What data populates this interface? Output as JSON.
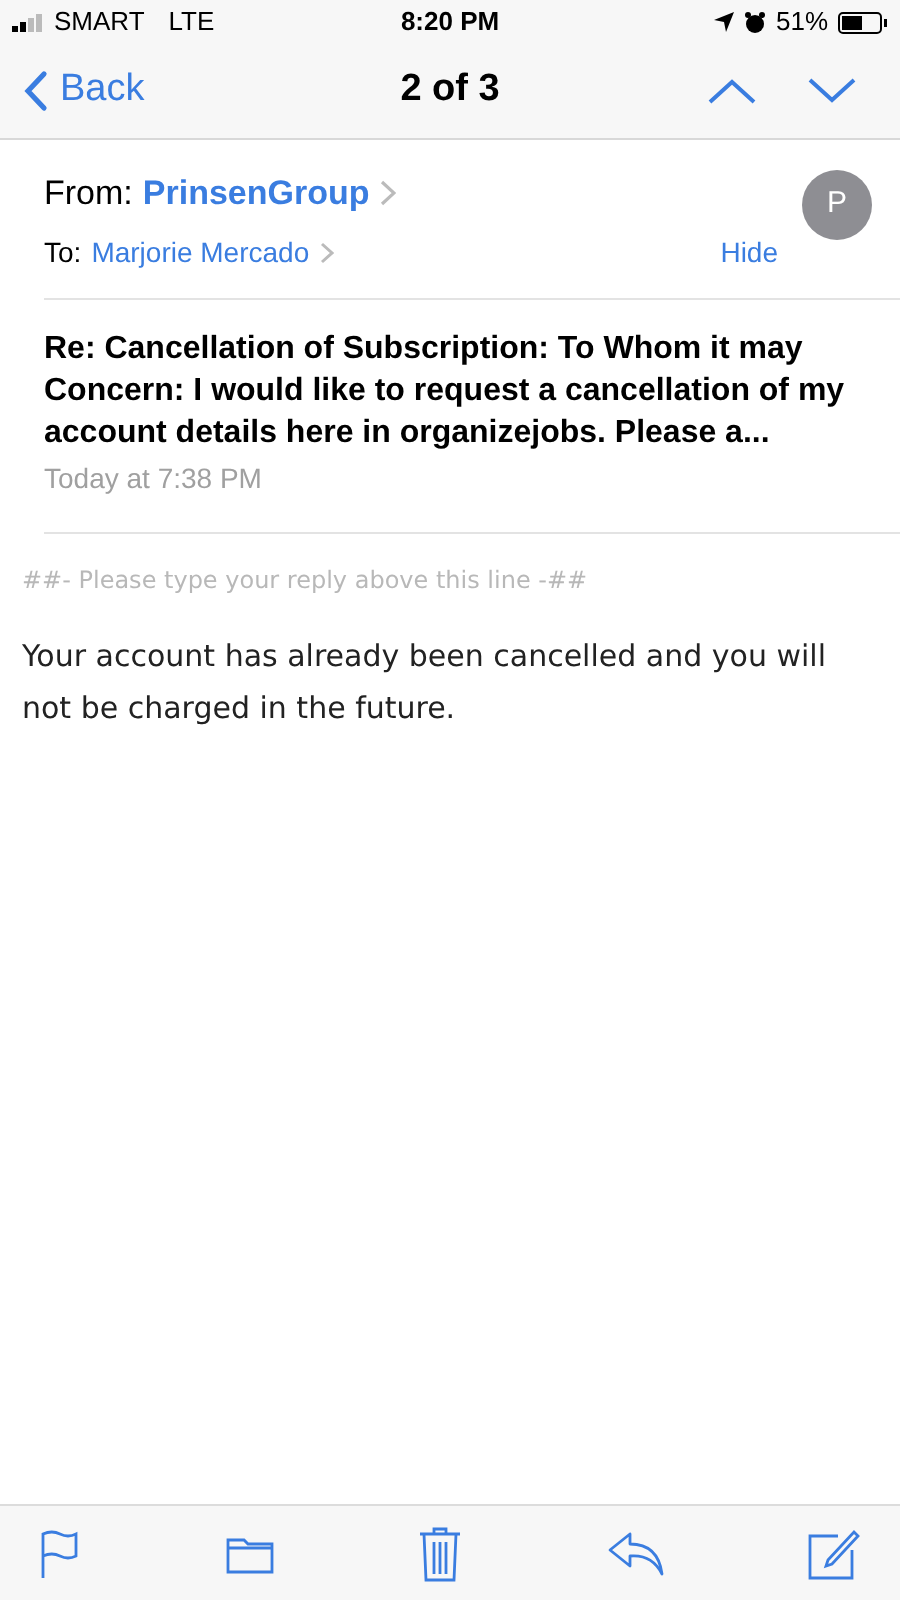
{
  "status_bar": {
    "carrier": "SMART",
    "network": "LTE",
    "time": "8:20 PM",
    "battery": "51%"
  },
  "nav": {
    "back": "Back",
    "title": "2 of 3"
  },
  "header": {
    "from_label": "From:",
    "from": "PrinsenGroup",
    "to_label": "To:",
    "to": "Marjorie Mercado",
    "hide": "Hide",
    "avatar": "P"
  },
  "message": {
    "subject": "Re: Cancellation of Subscription: To Whom it may Concern: I would like to request a cancellation of my account details here in organizejobs. Please a...",
    "date": "Today at 7:38 PM",
    "reply_line": "##- Please type your reply above this line -##",
    "body": "Your account has already been cancelled and you will not be charged in the future."
  }
}
